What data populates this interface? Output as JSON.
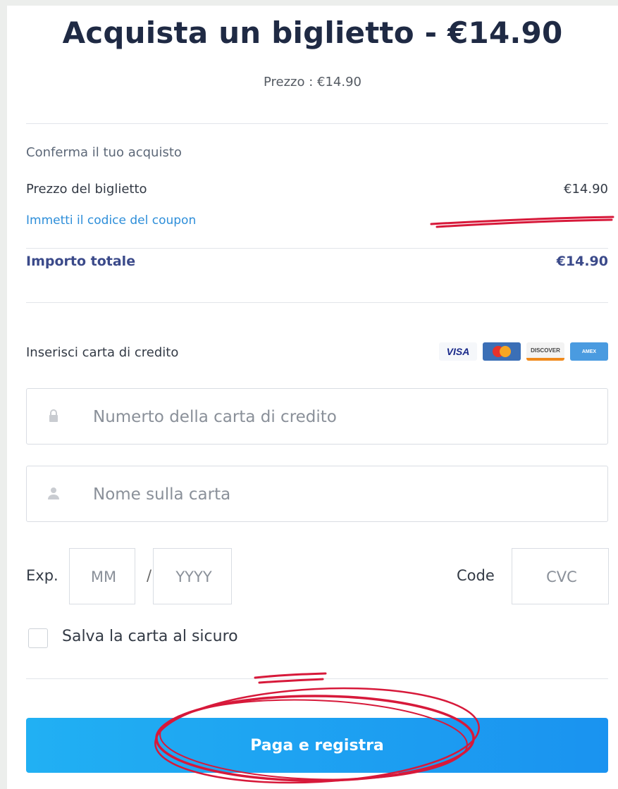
{
  "header": {
    "title": "Acquista un biglietto - €14.90",
    "subtitle": "Prezzo : €14.90"
  },
  "summary": {
    "section_label": "Conferma il tuo acquisto",
    "ticket_price_label": "Prezzo del biglietto",
    "ticket_price_value": "€14.90",
    "coupon_link": "Immetti il codice del coupon",
    "total_label": "Importo totale",
    "total_value": "€14.90"
  },
  "payment": {
    "card_label": "Inserisci carta di credito",
    "brands": [
      "VISA",
      "MasterCard",
      "DISCOVER",
      "American Express"
    ],
    "card_number_placeholder": "Numerto della carta di credito",
    "name_placeholder": "Nome sulla carta",
    "exp_label": "Exp.",
    "month_placeholder": "MM",
    "slash": "/",
    "year_placeholder": "YYYY",
    "code_label": "Code",
    "cvc_placeholder": "CVC",
    "save_card_label": "Salva la carta al sicuro"
  },
  "actions": {
    "pay_label": "Paga e registra"
  },
  "colors": {
    "accent": "#1a93f0",
    "link": "#2d8ed9",
    "total": "#3b4a8a",
    "annotation": "#d7193a"
  }
}
